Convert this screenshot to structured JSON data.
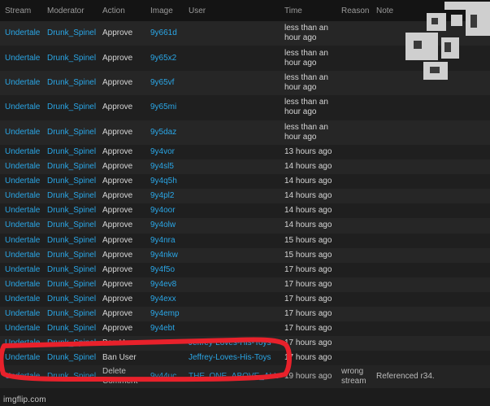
{
  "headers": [
    "Stream",
    "Moderator",
    "Action",
    "Image",
    "User",
    "Time",
    "Reason",
    "Note"
  ],
  "rows": [
    {
      "stream": "Undertale",
      "moderator": "Drunk_Spinel",
      "action": "Approve",
      "image": "9y661d",
      "user": "",
      "time": "less than an hour ago",
      "reason": "",
      "note": ""
    },
    {
      "stream": "Undertale",
      "moderator": "Drunk_Spinel",
      "action": "Approve",
      "image": "9y65x2",
      "user": "",
      "time": "less than an hour ago",
      "reason": "",
      "note": ""
    },
    {
      "stream": "Undertale",
      "moderator": "Drunk_Spinel",
      "action": "Approve",
      "image": "9y65vf",
      "user": "",
      "time": "less than an hour ago",
      "reason": "",
      "note": ""
    },
    {
      "stream": "Undertale",
      "moderator": "Drunk_Spinel",
      "action": "Approve",
      "image": "9y65mi",
      "user": "",
      "time": "less than an hour ago",
      "reason": "",
      "note": ""
    },
    {
      "stream": "Undertale",
      "moderator": "Drunk_Spinel",
      "action": "Approve",
      "image": "9y5daz",
      "user": "",
      "time": "less than an hour ago",
      "reason": "",
      "note": ""
    },
    {
      "stream": "Undertale",
      "moderator": "Drunk_Spinel",
      "action": "Approve",
      "image": "9y4vor",
      "user": "",
      "time": "13 hours ago",
      "reason": "",
      "note": ""
    },
    {
      "stream": "Undertale",
      "moderator": "Drunk_Spinel",
      "action": "Approve",
      "image": "9y4sl5",
      "user": "",
      "time": "14 hours ago",
      "reason": "",
      "note": ""
    },
    {
      "stream": "Undertale",
      "moderator": "Drunk_Spinel",
      "action": "Approve",
      "image": "9y4q5h",
      "user": "",
      "time": "14 hours ago",
      "reason": "",
      "note": ""
    },
    {
      "stream": "Undertale",
      "moderator": "Drunk_Spinel",
      "action": "Approve",
      "image": "9y4pl2",
      "user": "",
      "time": "14 hours ago",
      "reason": "",
      "note": ""
    },
    {
      "stream": "Undertale",
      "moderator": "Drunk_Spinel",
      "action": "Approve",
      "image": "9y4oor",
      "user": "",
      "time": "14 hours ago",
      "reason": "",
      "note": ""
    },
    {
      "stream": "Undertale",
      "moderator": "Drunk_Spinel",
      "action": "Approve",
      "image": "9y4olw",
      "user": "",
      "time": "14 hours ago",
      "reason": "",
      "note": ""
    },
    {
      "stream": "Undertale",
      "moderator": "Drunk_Spinel",
      "action": "Approve",
      "image": "9y4nra",
      "user": "",
      "time": "15 hours ago",
      "reason": "",
      "note": ""
    },
    {
      "stream": "Undertale",
      "moderator": "Drunk_Spinel",
      "action": "Approve",
      "image": "9y4nkw",
      "user": "",
      "time": "15 hours ago",
      "reason": "",
      "note": ""
    },
    {
      "stream": "Undertale",
      "moderator": "Drunk_Spinel",
      "action": "Approve",
      "image": "9y4f5o",
      "user": "",
      "time": "17 hours ago",
      "reason": "",
      "note": ""
    },
    {
      "stream": "Undertale",
      "moderator": "Drunk_Spinel",
      "action": "Approve",
      "image": "9y4ev8",
      "user": "",
      "time": "17 hours ago",
      "reason": "",
      "note": ""
    },
    {
      "stream": "Undertale",
      "moderator": "Drunk_Spinel",
      "action": "Approve",
      "image": "9y4exx",
      "user": "",
      "time": "17 hours ago",
      "reason": "",
      "note": ""
    },
    {
      "stream": "Undertale",
      "moderator": "Drunk_Spinel",
      "action": "Approve",
      "image": "9y4emp",
      "user": "",
      "time": "17 hours ago",
      "reason": "",
      "note": ""
    },
    {
      "stream": "Undertale",
      "moderator": "Drunk_Spinel",
      "action": "Approve",
      "image": "9y4ebt",
      "user": "",
      "time": "17 hours ago",
      "reason": "",
      "note": ""
    },
    {
      "stream": "Undertale",
      "moderator": "Drunk_Spinel",
      "action": "Ban User",
      "image": "",
      "user": "Jeffrey-Loves-His-Toys",
      "time": "17 hours ago",
      "reason": "",
      "note": ""
    },
    {
      "stream": "Undertale",
      "moderator": "Drunk_Spinel",
      "action": "Ban User",
      "image": "",
      "user": "Jeffrey-Loves-His-Toys",
      "time": "17 hours ago",
      "reason": "",
      "note": ""
    },
    {
      "stream": "Undertale",
      "moderator": "Drunk_Spinel",
      "action": "Delete Comment",
      "image": "9y44uc",
      "user": "THE_ONE_ABOVE_ALL",
      "time": "19 hours ago",
      "reason": "wrong stream",
      "note": "Referenced r34."
    }
  ],
  "watermark": "imgflip.com",
  "colors": {
    "link": "#2aa6e6",
    "highlight": "#e8212b",
    "background": "#1c1c1c"
  }
}
